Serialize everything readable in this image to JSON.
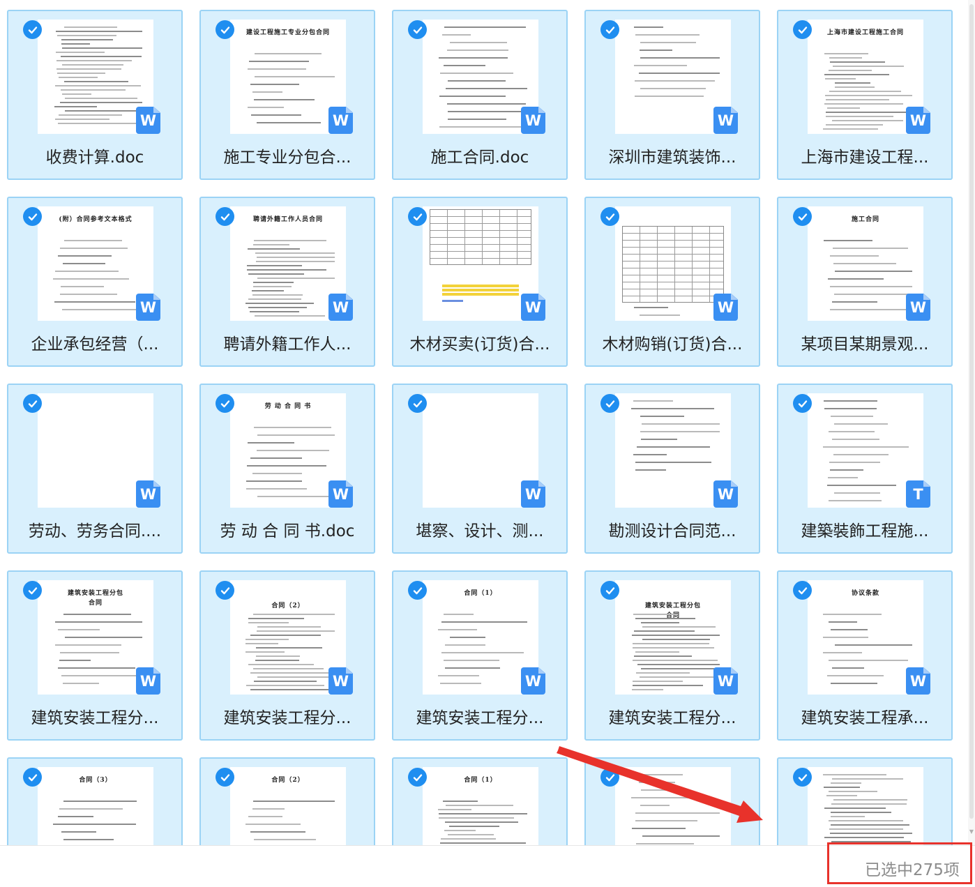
{
  "files": [
    {
      "name": "收费计算.doc",
      "badge": "W"
    },
    {
      "name": "施工专业分包合...",
      "badge": "W",
      "preview": "建设工程施工专业分包合同"
    },
    {
      "name": "施工合同.doc",
      "badge": "W"
    },
    {
      "name": "深圳市建筑装饰...",
      "badge": "W"
    },
    {
      "name": "上海市建设工程...",
      "badge": "W",
      "preview": "上海市建设工程施工合同"
    },
    {
      "name": "企业承包经营（...",
      "badge": "W",
      "preview": "(附）合同参考文本格式"
    },
    {
      "name": "聘请外籍工作人...",
      "badge": "W",
      "preview": "聘请外籍工作人员合同"
    },
    {
      "name": "木材买卖(订货)合...",
      "badge": "W"
    },
    {
      "name": "木材购销(订货)合...",
      "badge": "W"
    },
    {
      "name": "某项目某期景观...",
      "badge": "W",
      "preview": "施工合同"
    },
    {
      "name": "劳动、劳务合同....",
      "badge": "W"
    },
    {
      "name": "劳 动 合 同 书.doc",
      "badge": "W",
      "preview": "劳 动 合 同 书"
    },
    {
      "name": "堪察、设计、测...",
      "badge": "W"
    },
    {
      "name": "勘测设计合同范...",
      "badge": "W"
    },
    {
      "name": "建築裝飾工程施...",
      "badge": "T"
    },
    {
      "name": "建筑安装工程分...",
      "badge": "W",
      "preview": "建筑安装工程分包\n合同"
    },
    {
      "name": "建筑安装工程分...",
      "badge": "W",
      "preview": "合同（2）"
    },
    {
      "name": "建筑安装工程分...",
      "badge": "W",
      "preview": "合同（1）"
    },
    {
      "name": "建筑安装工程分...",
      "badge": "W",
      "preview": "建筑安装工程分包\n合同"
    },
    {
      "name": "建筑安装工程承...",
      "badge": "W",
      "preview": "协议条款"
    },
    {
      "name": "",
      "badge": "",
      "preview": "合同（3）"
    },
    {
      "name": "",
      "badge": "",
      "preview": "合同（2）"
    },
    {
      "name": "",
      "badge": "",
      "preview": "合同（1）"
    },
    {
      "name": "",
      "badge": ""
    },
    {
      "name": "",
      "badge": ""
    }
  ],
  "status": {
    "selected_text": "已选中275项"
  },
  "colors": {
    "accent": "#1f8ef0",
    "tile_bg": "#d9f0fd",
    "annotation": "#e8322b"
  }
}
